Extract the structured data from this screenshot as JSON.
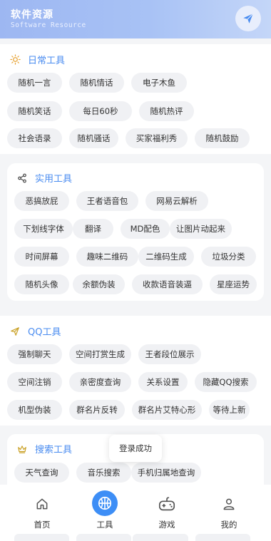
{
  "header": {
    "title": "软件资源",
    "subtitle": "Software Resource",
    "send_icon": "paper-plane-icon"
  },
  "sections": {
    "daily": {
      "title": "日常工具",
      "icon": "sun-icon",
      "items": [
        "随机一言",
        "随机情话",
        "电子木鱼",
        "随机笑话",
        "每日60秒",
        "随机热评",
        "社会语录",
        "随机骚话",
        "买家福利秀",
        "随机鼓励"
      ]
    },
    "practical": {
      "title": "实用工具",
      "icon": "share-icon",
      "items": [
        "恶搞放屁",
        "王者语音包",
        "网易云解析",
        "下划线字体",
        "翻译",
        "MD配色",
        "让图片动起来",
        "时间屏幕",
        "趣味二维码",
        "二维码生成",
        "垃圾分类",
        "随机头像",
        "余额伪装",
        "收款语音装逼",
        "星座运势"
      ]
    },
    "qq": {
      "title": "QQ工具",
      "icon": "paper-plane-icon",
      "items": [
        "强制聊天",
        "空间打赏生成",
        "王者段位展示",
        "空间注销",
        "亲密度查询",
        "关系设置",
        "隐藏QQ搜索",
        "机型伪装",
        "群名片反转",
        "群名片艾特心形",
        "等待上新"
      ]
    },
    "search": {
      "title": "搜索工具",
      "icon": "crown-icon",
      "items": [
        "天气查询",
        "音乐搜索",
        "手机归属地查询"
      ]
    }
  },
  "toast": "登录成功",
  "tabbar": {
    "tabs": [
      {
        "label": "首页",
        "icon": "home-icon"
      },
      {
        "label": "工具",
        "icon": "basketball-icon"
      },
      {
        "label": "游戏",
        "icon": "gamepad-icon"
      },
      {
        "label": "我的",
        "icon": "user-icon"
      }
    ],
    "active": "工具"
  },
  "colors": {
    "accent": "#4a8cf0",
    "tab_active": "#3d8ef6",
    "chip_bg": "#f0f1f4"
  }
}
